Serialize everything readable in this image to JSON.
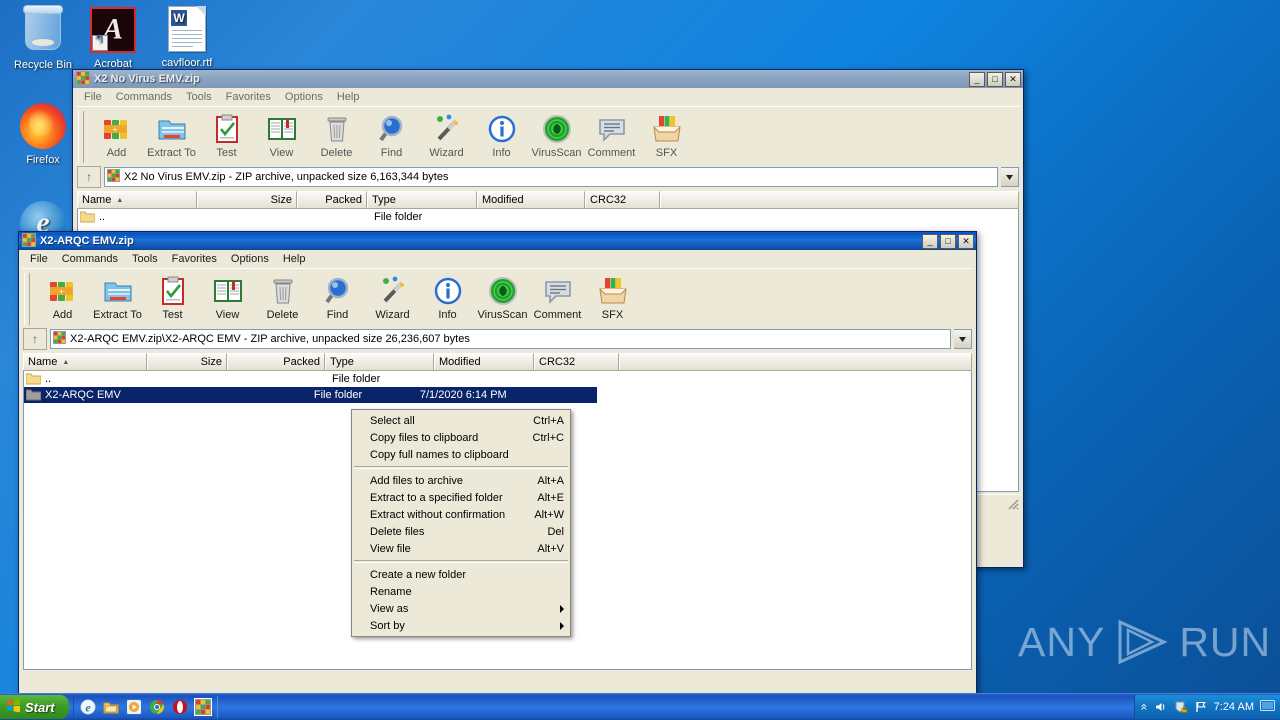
{
  "desktop": {
    "icons": [
      {
        "label": "Recycle Bin",
        "icon": "recycle-bin-icon"
      },
      {
        "label": "Acrobat",
        "icon": "acrobat-icon"
      },
      {
        "label": "cavfloor.rtf",
        "icon": "rtf-document-icon"
      },
      {
        "label": "Firefox",
        "icon": "firefox-icon"
      }
    ],
    "watermark": "ANY RUN",
    "watermark_parts": {
      "left": "ANY",
      "right": "RUN"
    }
  },
  "window_back": {
    "title": "X2 No Virus EMV.zip",
    "menu": [
      "File",
      "Commands",
      "Tools",
      "Favorites",
      "Options",
      "Help"
    ],
    "window_buttons": {
      "minimize": "_",
      "maximize": "□",
      "close": "✕"
    },
    "toolbar": [
      {
        "label": "Add",
        "icon": "add-archive-icon"
      },
      {
        "label": "Extract To",
        "icon": "extract-folder-icon"
      },
      {
        "label": "Test",
        "icon": "test-clipboard-icon"
      },
      {
        "label": "View",
        "icon": "view-book-icon"
      },
      {
        "label": "Delete",
        "icon": "delete-trash-icon"
      },
      {
        "label": "Find",
        "icon": "find-magnifier-icon"
      },
      {
        "label": "Wizard",
        "icon": "wizard-wand-icon"
      },
      {
        "label": "Info",
        "icon": "info-circle-icon"
      },
      {
        "label": "VirusScan",
        "icon": "virusscan-radar-icon"
      },
      {
        "label": "Comment",
        "icon": "comment-bubble-icon"
      },
      {
        "label": "SFX",
        "icon": "sfx-box-icon"
      }
    ],
    "up_button": "↑",
    "path": "X2 No Virus EMV.zip - ZIP archive, unpacked size 6,163,344 bytes",
    "columns": [
      {
        "label": "Name",
        "sort": "▲"
      },
      {
        "label": "Size"
      },
      {
        "label": "Packed"
      },
      {
        "label": "Type"
      },
      {
        "label": "Modified"
      },
      {
        "label": "CRC32"
      }
    ],
    "rows": [
      {
        "name": "..",
        "size": "",
        "packed": "",
        "type": "File folder",
        "modified": "",
        "crc32": ""
      }
    ]
  },
  "window_front": {
    "title": "X2-ARQC EMV.zip",
    "menu": [
      "File",
      "Commands",
      "Tools",
      "Favorites",
      "Options",
      "Help"
    ],
    "window_buttons": {
      "minimize": "_",
      "maximize": "□",
      "close": "✕"
    },
    "toolbar": [
      {
        "label": "Add",
        "icon": "add-archive-icon"
      },
      {
        "label": "Extract To",
        "icon": "extract-folder-icon"
      },
      {
        "label": "Test",
        "icon": "test-clipboard-icon"
      },
      {
        "label": "View",
        "icon": "view-book-icon"
      },
      {
        "label": "Delete",
        "icon": "delete-trash-icon"
      },
      {
        "label": "Find",
        "icon": "find-magnifier-icon"
      },
      {
        "label": "Wizard",
        "icon": "wizard-wand-icon"
      },
      {
        "label": "Info",
        "icon": "info-circle-icon"
      },
      {
        "label": "VirusScan",
        "icon": "virusscan-radar-icon"
      },
      {
        "label": "Comment",
        "icon": "comment-bubble-icon"
      },
      {
        "label": "SFX",
        "icon": "sfx-box-icon"
      }
    ],
    "up_button": "↑",
    "path": "X2-ARQC EMV.zip\\X2-ARQC EMV - ZIP archive, unpacked size 26,236,607 bytes",
    "columns": [
      {
        "label": "Name",
        "sort": "▲"
      },
      {
        "label": "Size"
      },
      {
        "label": "Packed"
      },
      {
        "label": "Type"
      },
      {
        "label": "Modified"
      },
      {
        "label": "CRC32"
      }
    ],
    "rows": [
      {
        "name": "..",
        "size": "",
        "packed": "",
        "type": "File folder",
        "modified": "",
        "crc32": "",
        "selected": false
      },
      {
        "name": "X2-ARQC EMV",
        "size": "",
        "packed": "",
        "type": "File folder",
        "modified": "7/1/2020 6:14 PM",
        "crc32": "",
        "selected": true
      }
    ]
  },
  "context_menu": {
    "groups": [
      [
        {
          "label": "Select all",
          "accel": "Ctrl+A"
        },
        {
          "label": "Copy files to clipboard",
          "accel": "Ctrl+C"
        },
        {
          "label": "Copy full names to clipboard",
          "accel": ""
        }
      ],
      [
        {
          "label": "Add files to archive",
          "accel": "Alt+A"
        },
        {
          "label": "Extract to a specified folder",
          "accel": "Alt+E"
        },
        {
          "label": "Extract without confirmation",
          "accel": "Alt+W"
        },
        {
          "label": "Delete files",
          "accel": "Del"
        },
        {
          "label": "View file",
          "accel": "Alt+V"
        }
      ],
      [
        {
          "label": "Create a new folder",
          "accel": ""
        },
        {
          "label": "Rename",
          "accel": ""
        },
        {
          "label": "View as",
          "accel": "",
          "submenu": true
        },
        {
          "label": "Sort by",
          "accel": "",
          "submenu": true
        }
      ]
    ]
  },
  "taskbar": {
    "start_label": "Start",
    "quicklaunch": [
      {
        "name": "internet-explorer-icon"
      },
      {
        "name": "show-desktop-icon"
      },
      {
        "name": "media-player-icon"
      },
      {
        "name": "chrome-icon"
      },
      {
        "name": "opera-icon"
      },
      {
        "name": "winrar-taskbar-icon"
      }
    ],
    "tray": {
      "expand": "«",
      "icons": [
        "volume-icon",
        "security-alert-icon",
        "network-flag-icon"
      ],
      "time": "7:24 AM",
      "extra": "display-icon"
    }
  },
  "colors": {
    "desktop_blue": "#1b72c9",
    "title_active": "#0a52bb",
    "title_inactive": "#8aa3c0",
    "face": "#ece9d8",
    "selection": "#0a246a"
  }
}
